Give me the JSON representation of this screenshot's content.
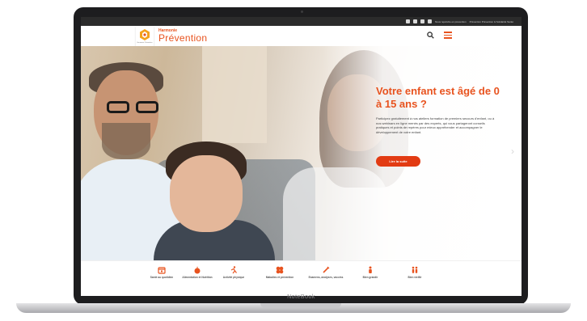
{
  "device": {
    "bezel_label": "NoteBook"
  },
  "topbar": {
    "icons": [
      "accessibility-icon",
      "facebook-icon",
      "instagram-icon",
      "youtube-icon"
    ],
    "links": [
      "Nous rejoindre en prévention",
      "Prévention Prévention & Solidarité Santé"
    ]
  },
  "header": {
    "brand_top": "Harmonie",
    "brand_name": "Prévention",
    "logo_small": "Harmonie Prévention",
    "search_icon": "search-icon",
    "menu_icon": "hamburger-menu-icon"
  },
  "hero": {
    "title": "Votre enfant est âgé de 0 à 15 ans ?",
    "text": "Participez gratuitement à nos ateliers formation de premiers secours d'enfant, ou à nos webinars en ligne menés par des experts, qui vous partageront conseils pratiques et points de repères pour mieux appréhender et accompagner le développement de votre enfant.",
    "cta": "Lire la suite",
    "next_icon": "chevron-right-icon"
  },
  "categories": [
    {
      "label": "Santé au quotidien",
      "icon": "calendar-icon"
    },
    {
      "label": "Alimentation et Nutrition",
      "icon": "apple-icon"
    },
    {
      "label": "Activité physique",
      "icon": "runner-icon"
    },
    {
      "label": "Maladies et prévention",
      "icon": "virus-icon"
    },
    {
      "label": "Examens, analyses, vaccins",
      "icon": "syringe-icon"
    },
    {
      "label": "Bien grandir",
      "icon": "child-icon"
    },
    {
      "label": "Bien vieillir",
      "icon": "couple-icon"
    }
  ],
  "colors": {
    "accent": "#e8531f",
    "cta": "#e23b13",
    "topbar": "#2b2b2b"
  }
}
